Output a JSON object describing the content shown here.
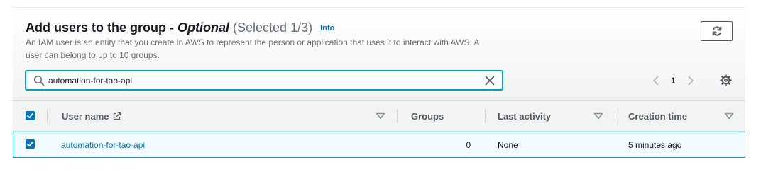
{
  "section": {
    "title_main": "Add users to the group - ",
    "title_optional": "Optional",
    "title_selected": "(Selected 1/3)",
    "info_label": "Info",
    "description": "An IAM user is an entity that you create in AWS to represent the person or application that uses it to interact with AWS. A user can belong to up to 10 groups."
  },
  "toolbar": {
    "refresh_icon": "refresh-icon"
  },
  "search": {
    "value": "automation-for-tao-api",
    "placeholder": "",
    "icon": "search-icon",
    "clear_icon": "close-icon"
  },
  "pagination": {
    "current_page": "1",
    "prev_icon": "chevron-left-icon",
    "next_icon": "chevron-right-icon",
    "settings_icon": "gear-icon"
  },
  "table": {
    "columns": [
      {
        "label": "User name",
        "icon": "external-link-icon",
        "sortable": true
      },
      {
        "label": "Groups",
        "sortable": false
      },
      {
        "label": "Last activity",
        "sortable": true
      },
      {
        "label": "Creation time",
        "sortable": true
      }
    ],
    "rows": [
      {
        "selected": true,
        "user_name": "automation-for-tao-api",
        "groups": "0",
        "last_activity": "None",
        "creation_time": "5 minutes ago"
      }
    ]
  },
  "colors": {
    "accent": "#0073bb",
    "focus": "#00a1c9",
    "selected_row_bg": "#f1faff",
    "muted_text": "#687078"
  }
}
